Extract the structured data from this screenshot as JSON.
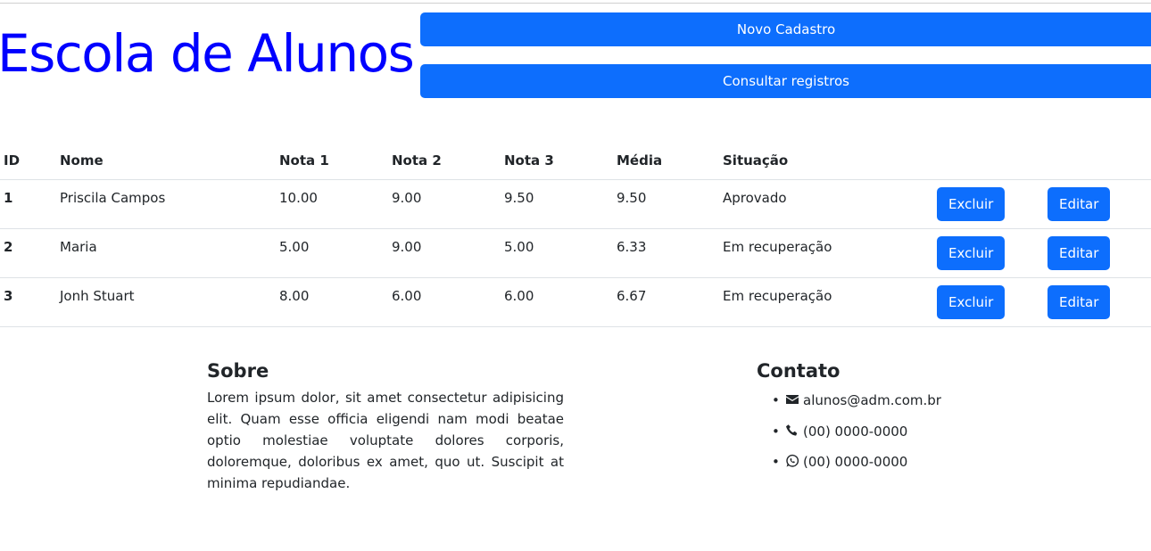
{
  "header": {
    "title": "Escola de Alunos",
    "new_button": "Novo Cadastro",
    "query_button": "Consultar registros"
  },
  "table": {
    "columns": [
      "ID",
      "Nome",
      "Nota 1",
      "Nota 2",
      "Nota 3",
      "Média",
      "Situação"
    ],
    "rows": [
      {
        "id": "1",
        "nome": "Priscila Campos",
        "nota1": "10.00",
        "nota2": "9.00",
        "nota3": "9.50",
        "media": "9.50",
        "situacao": "Aprovado",
        "delete_label": "Excluir",
        "edit_label": "Editar"
      },
      {
        "id": "2",
        "nome": "Maria",
        "nota1": "5.00",
        "nota2": "9.00",
        "nota3": "5.00",
        "media": "6.33",
        "situacao": "Em recuperação",
        "delete_label": "Excluir",
        "edit_label": "Editar"
      },
      {
        "id": "3",
        "nome": "Jonh Stuart",
        "nota1": "8.00",
        "nota2": "6.00",
        "nota3": "6.00",
        "media": "6.67",
        "situacao": "Em recuperação",
        "delete_label": "Excluir",
        "edit_label": "Editar"
      }
    ]
  },
  "footer": {
    "about_title": "Sobre",
    "about_text": "Lorem ipsum dolor, sit amet consectetur adipisicing elit. Quam esse officia eligendi nam modi beatae optio molestiae voluptate dolores corporis, doloremque, doloribus ex amet, quo ut. Suscipit at minima repudiandae.",
    "contact_title": "Contato",
    "contacts": [
      {
        "icon": "envelope-icon",
        "text": "alunos@adm.com.br"
      },
      {
        "icon": "phone-icon",
        "text": "(00) 0000-0000"
      },
      {
        "icon": "whatsapp-icon",
        "text": "(00) 0000-0000"
      }
    ]
  },
  "colors": {
    "title": "#0000ff",
    "primary": "#0d6efd"
  }
}
